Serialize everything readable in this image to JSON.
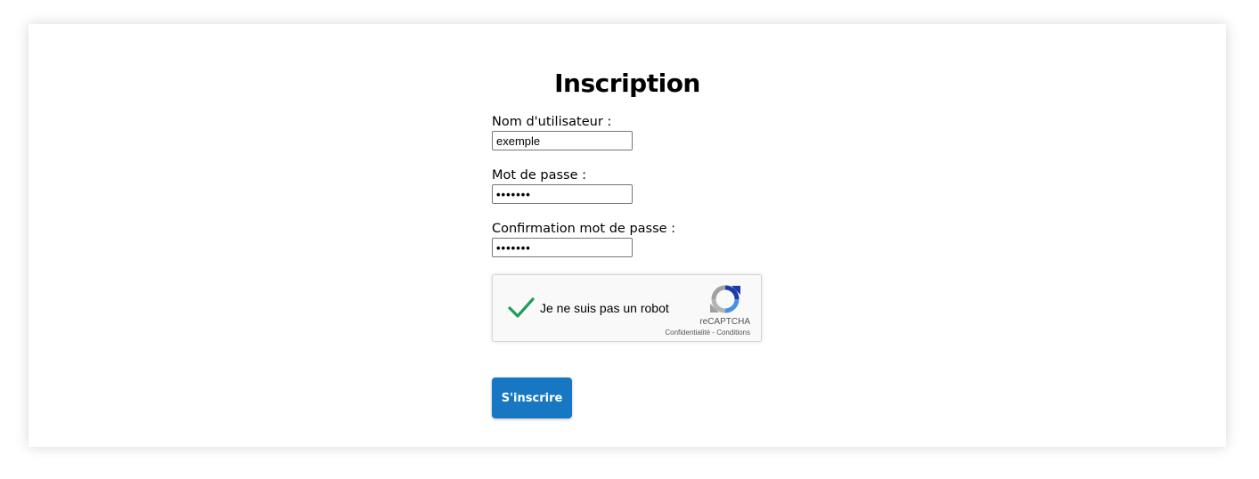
{
  "page": {
    "title": "Inscription"
  },
  "form": {
    "username": {
      "label": "Nom d'utilisateur :",
      "value": "exemple"
    },
    "password": {
      "label": "Mot de passe :",
      "value": "•••••••"
    },
    "password_confirm": {
      "label": "Confirmation mot de passe :",
      "value": "•••••••"
    },
    "submit_label": "S'inscrire"
  },
  "recaptcha": {
    "checked": true,
    "label": "Je ne suis pas un robot",
    "brand": "reCAPTCHA",
    "privacy_link": "Confidentialité",
    "separator": " - ",
    "terms_link": "Conditions"
  },
  "colors": {
    "accent": "#1777c2",
    "check": "#1e9e58"
  }
}
